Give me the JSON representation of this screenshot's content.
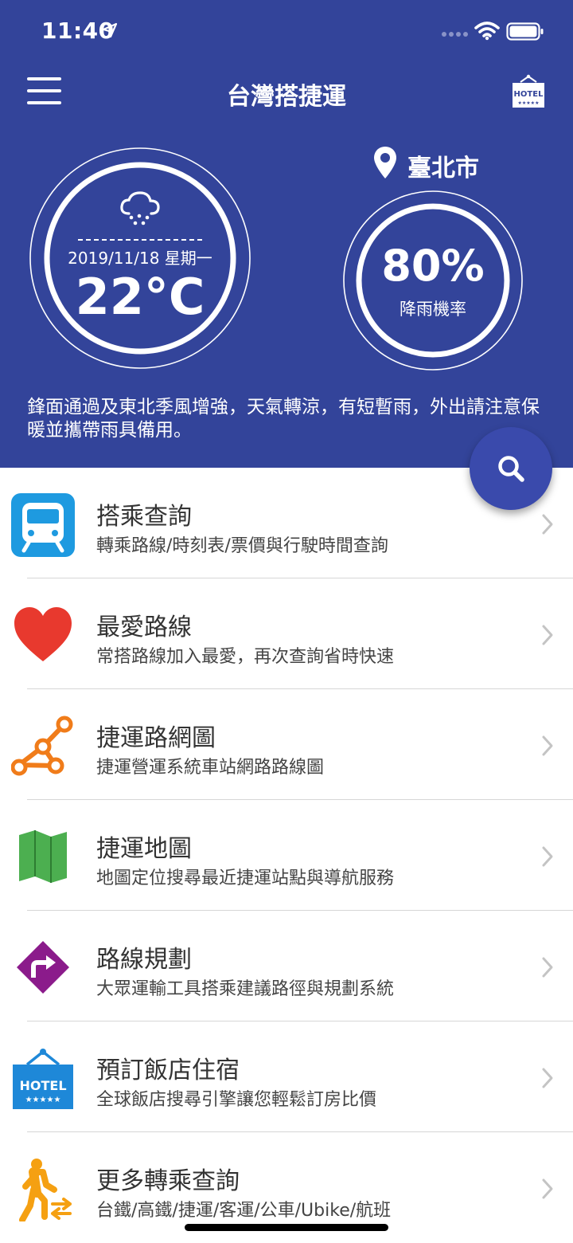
{
  "status_bar": {
    "time": "11:40"
  },
  "header": {
    "title": "台灣搭捷運"
  },
  "weather": {
    "date": "2019/11/18 星期一",
    "temperature": "22°C",
    "city": "臺北市",
    "rain_probability": "80%",
    "rain_label": "降雨機率",
    "forecast": "鋒面通過及東北季風增強，天氣轉涼，有短暫雨，外出請注意保暖並攜帶雨具備用。"
  },
  "hotel_sign": {
    "label": "HOTEL",
    "stars": "★★★★★"
  },
  "menu": [
    {
      "title": "搭乘查詢",
      "subtitle": "轉乘路線/時刻表/票價與行駛時間查詢",
      "icon": "train-icon"
    },
    {
      "title": "最愛路線",
      "subtitle": "常搭路線加入最愛，再次查詢省時快速",
      "icon": "heart-icon"
    },
    {
      "title": "捷運路網圖",
      "subtitle": "捷運營運系統車站網路路線圖",
      "icon": "route-network-icon"
    },
    {
      "title": "捷運地圖",
      "subtitle": "地圖定位搜尋最近捷運站點與導航服務",
      "icon": "map-icon"
    },
    {
      "title": "路線規劃",
      "subtitle": "大眾運輸工具搭乘建議路徑與規劃系統",
      "icon": "directions-icon"
    },
    {
      "title": "預訂飯店住宿",
      "subtitle": "全球飯店搜尋引擎讓您輕鬆訂房比價",
      "icon": "hotel-icon"
    },
    {
      "title": "更多轉乘查詢",
      "subtitle": "台鐵/高鐵/捷運/客運/公車/Ubike/航班",
      "icon": "transfer-walk-icon"
    }
  ],
  "colors": {
    "header_bg": "#33449a",
    "fab_bg": "#3a4aac",
    "train_blue": "#1e9ae0",
    "heart_red": "#e8392e",
    "network_orange": "#f07c1a",
    "map_green": "#4caf50",
    "directions_purple": "#8b1b8b",
    "hotel_blue": "#1e88d8"
  }
}
